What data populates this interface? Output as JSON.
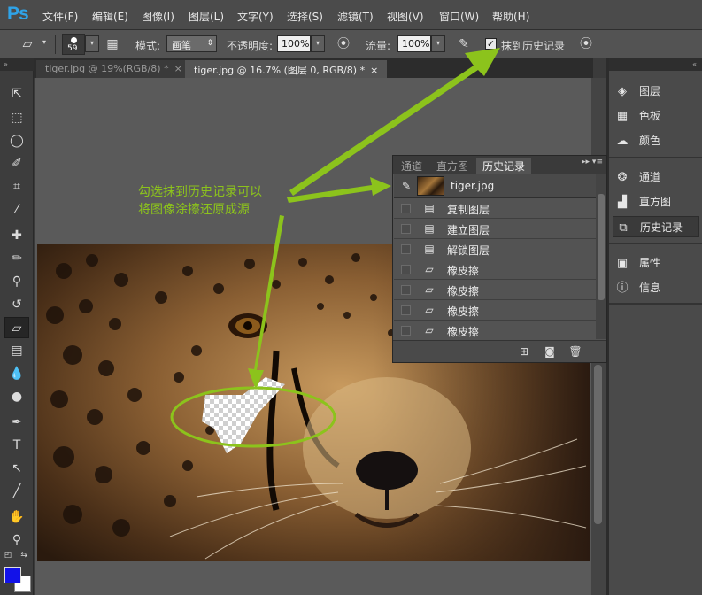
{
  "app": {
    "logo": "Ps"
  },
  "menu": [
    "文件(F)",
    "编辑(E)",
    "图像(I)",
    "图层(L)",
    "文字(Y)",
    "选择(S)",
    "滤镜(T)",
    "视图(V)",
    "窗口(W)",
    "帮助(H)"
  ],
  "options": {
    "brush_size": "59",
    "mode_label": "模式:",
    "mode_value": "画笔",
    "opacity_label": "不透明度:",
    "opacity_value": "100%",
    "flow_label": "流量:",
    "flow_value": "100%",
    "erase_to_history_label": "抹到历史记录",
    "erase_to_history_checked": "✓"
  },
  "doc_tabs": [
    {
      "label": "tiger.jpg @ 19%(RGB/8) *",
      "close": "×"
    },
    {
      "label": "tiger.jpg @ 16.7% (图层 0, RGB/8) *",
      "close": "×"
    }
  ],
  "right_dock": {
    "groups": [
      [
        {
          "label": "图层",
          "icon": "layers-icon"
        },
        {
          "label": "色板",
          "icon": "swatches-icon"
        },
        {
          "label": "颜色",
          "icon": "color-icon"
        }
      ],
      [
        {
          "label": "通道",
          "icon": "channels-icon"
        },
        {
          "label": "直方图",
          "icon": "histogram-icon"
        },
        {
          "label": "历史记录",
          "icon": "history-icon"
        }
      ],
      [
        {
          "label": "属性",
          "icon": "properties-icon"
        },
        {
          "label": "信息",
          "icon": "info-icon"
        }
      ]
    ]
  },
  "history_panel": {
    "tabs": [
      "通道",
      "直方图",
      "历史记录"
    ],
    "snapshot": "tiger.jpg",
    "items": [
      "复制图层",
      "建立图层",
      "解锁图层",
      "橡皮擦",
      "橡皮擦",
      "橡皮擦",
      "橡皮擦"
    ]
  },
  "annotation": {
    "line1": "勾选抹到历史记录可以",
    "line2": "将图像涂擦还原成源",
    "color": "#8cc31c"
  }
}
